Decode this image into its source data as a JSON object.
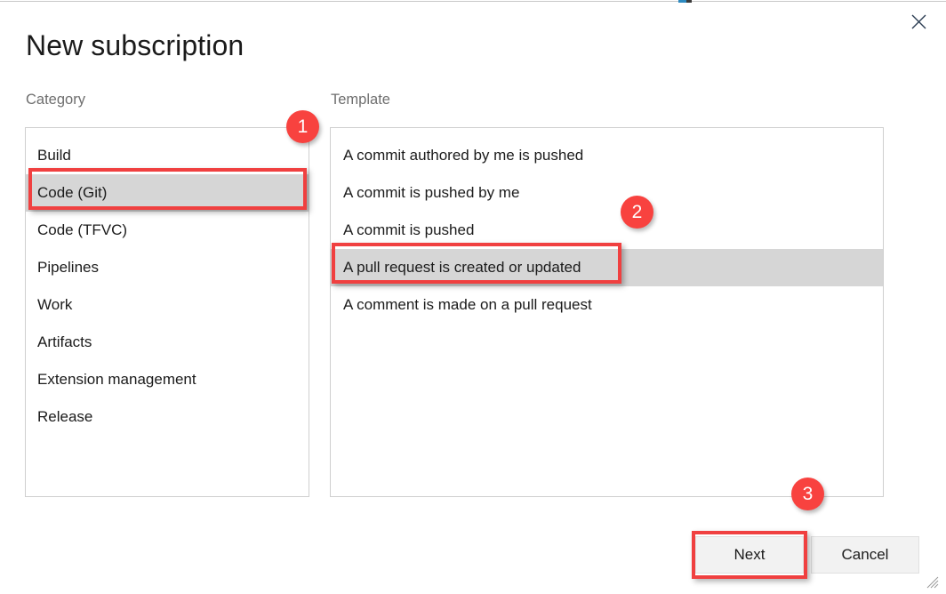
{
  "window": {
    "title": "New subscription",
    "close_icon": "close-icon",
    "accent_color": "#2d8ac0"
  },
  "labels": {
    "category": "Category",
    "template": "Template"
  },
  "category_list": {
    "items": [
      {
        "label": "Build",
        "selected": false
      },
      {
        "label": "Code (Git)",
        "selected": true
      },
      {
        "label": "Code (TFVC)",
        "selected": false
      },
      {
        "label": "Pipelines",
        "selected": false
      },
      {
        "label": "Work",
        "selected": false
      },
      {
        "label": "Artifacts",
        "selected": false
      },
      {
        "label": "Extension management",
        "selected": false
      },
      {
        "label": "Release",
        "selected": false
      }
    ],
    "selected_value": "Code (Git)"
  },
  "template_list": {
    "items": [
      {
        "label": "A commit authored by me is pushed",
        "selected": false
      },
      {
        "label": "A commit is pushed by me",
        "selected": false
      },
      {
        "label": "A commit is pushed",
        "selected": false
      },
      {
        "label": "A pull request is created or updated",
        "selected": true
      },
      {
        "label": "A comment is made on a pull request",
        "selected": false
      }
    ],
    "selected_value": "A pull request is created or updated"
  },
  "footer": {
    "next_label": "Next",
    "cancel_label": "Cancel"
  },
  "annotations": {
    "color": "#f8423f",
    "badges": [
      {
        "number": "1",
        "target": "category-selected-row"
      },
      {
        "number": "2",
        "target": "template-selected-row"
      },
      {
        "number": "3",
        "target": "next-button"
      }
    ]
  }
}
